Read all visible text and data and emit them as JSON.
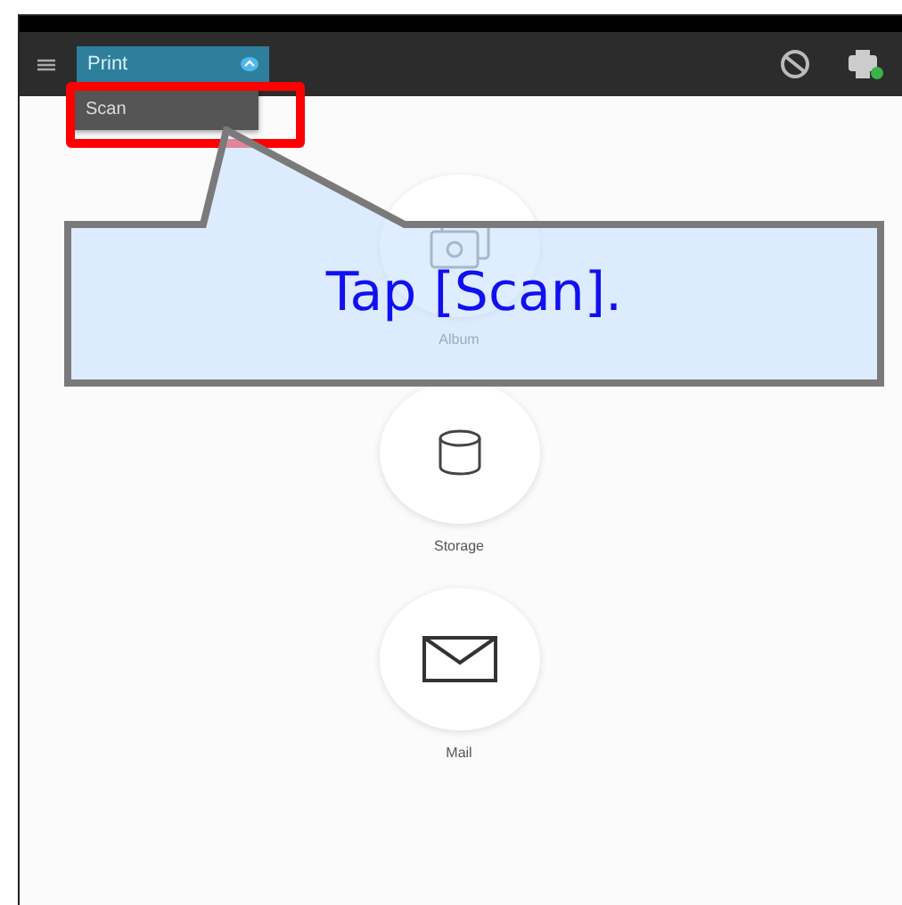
{
  "toolbar": {
    "mode_dropdown": {
      "value": "Print",
      "expanded": true
    },
    "menu_items": [
      {
        "label": "Scan",
        "highlighted": true
      }
    ]
  },
  "actions": [
    {
      "label": "Album",
      "kind": "album"
    },
    {
      "label": "Storage",
      "kind": "storage"
    },
    {
      "label": "Mail",
      "kind": "mail"
    }
  ],
  "callout": {
    "text": "Tap [Scan]."
  }
}
